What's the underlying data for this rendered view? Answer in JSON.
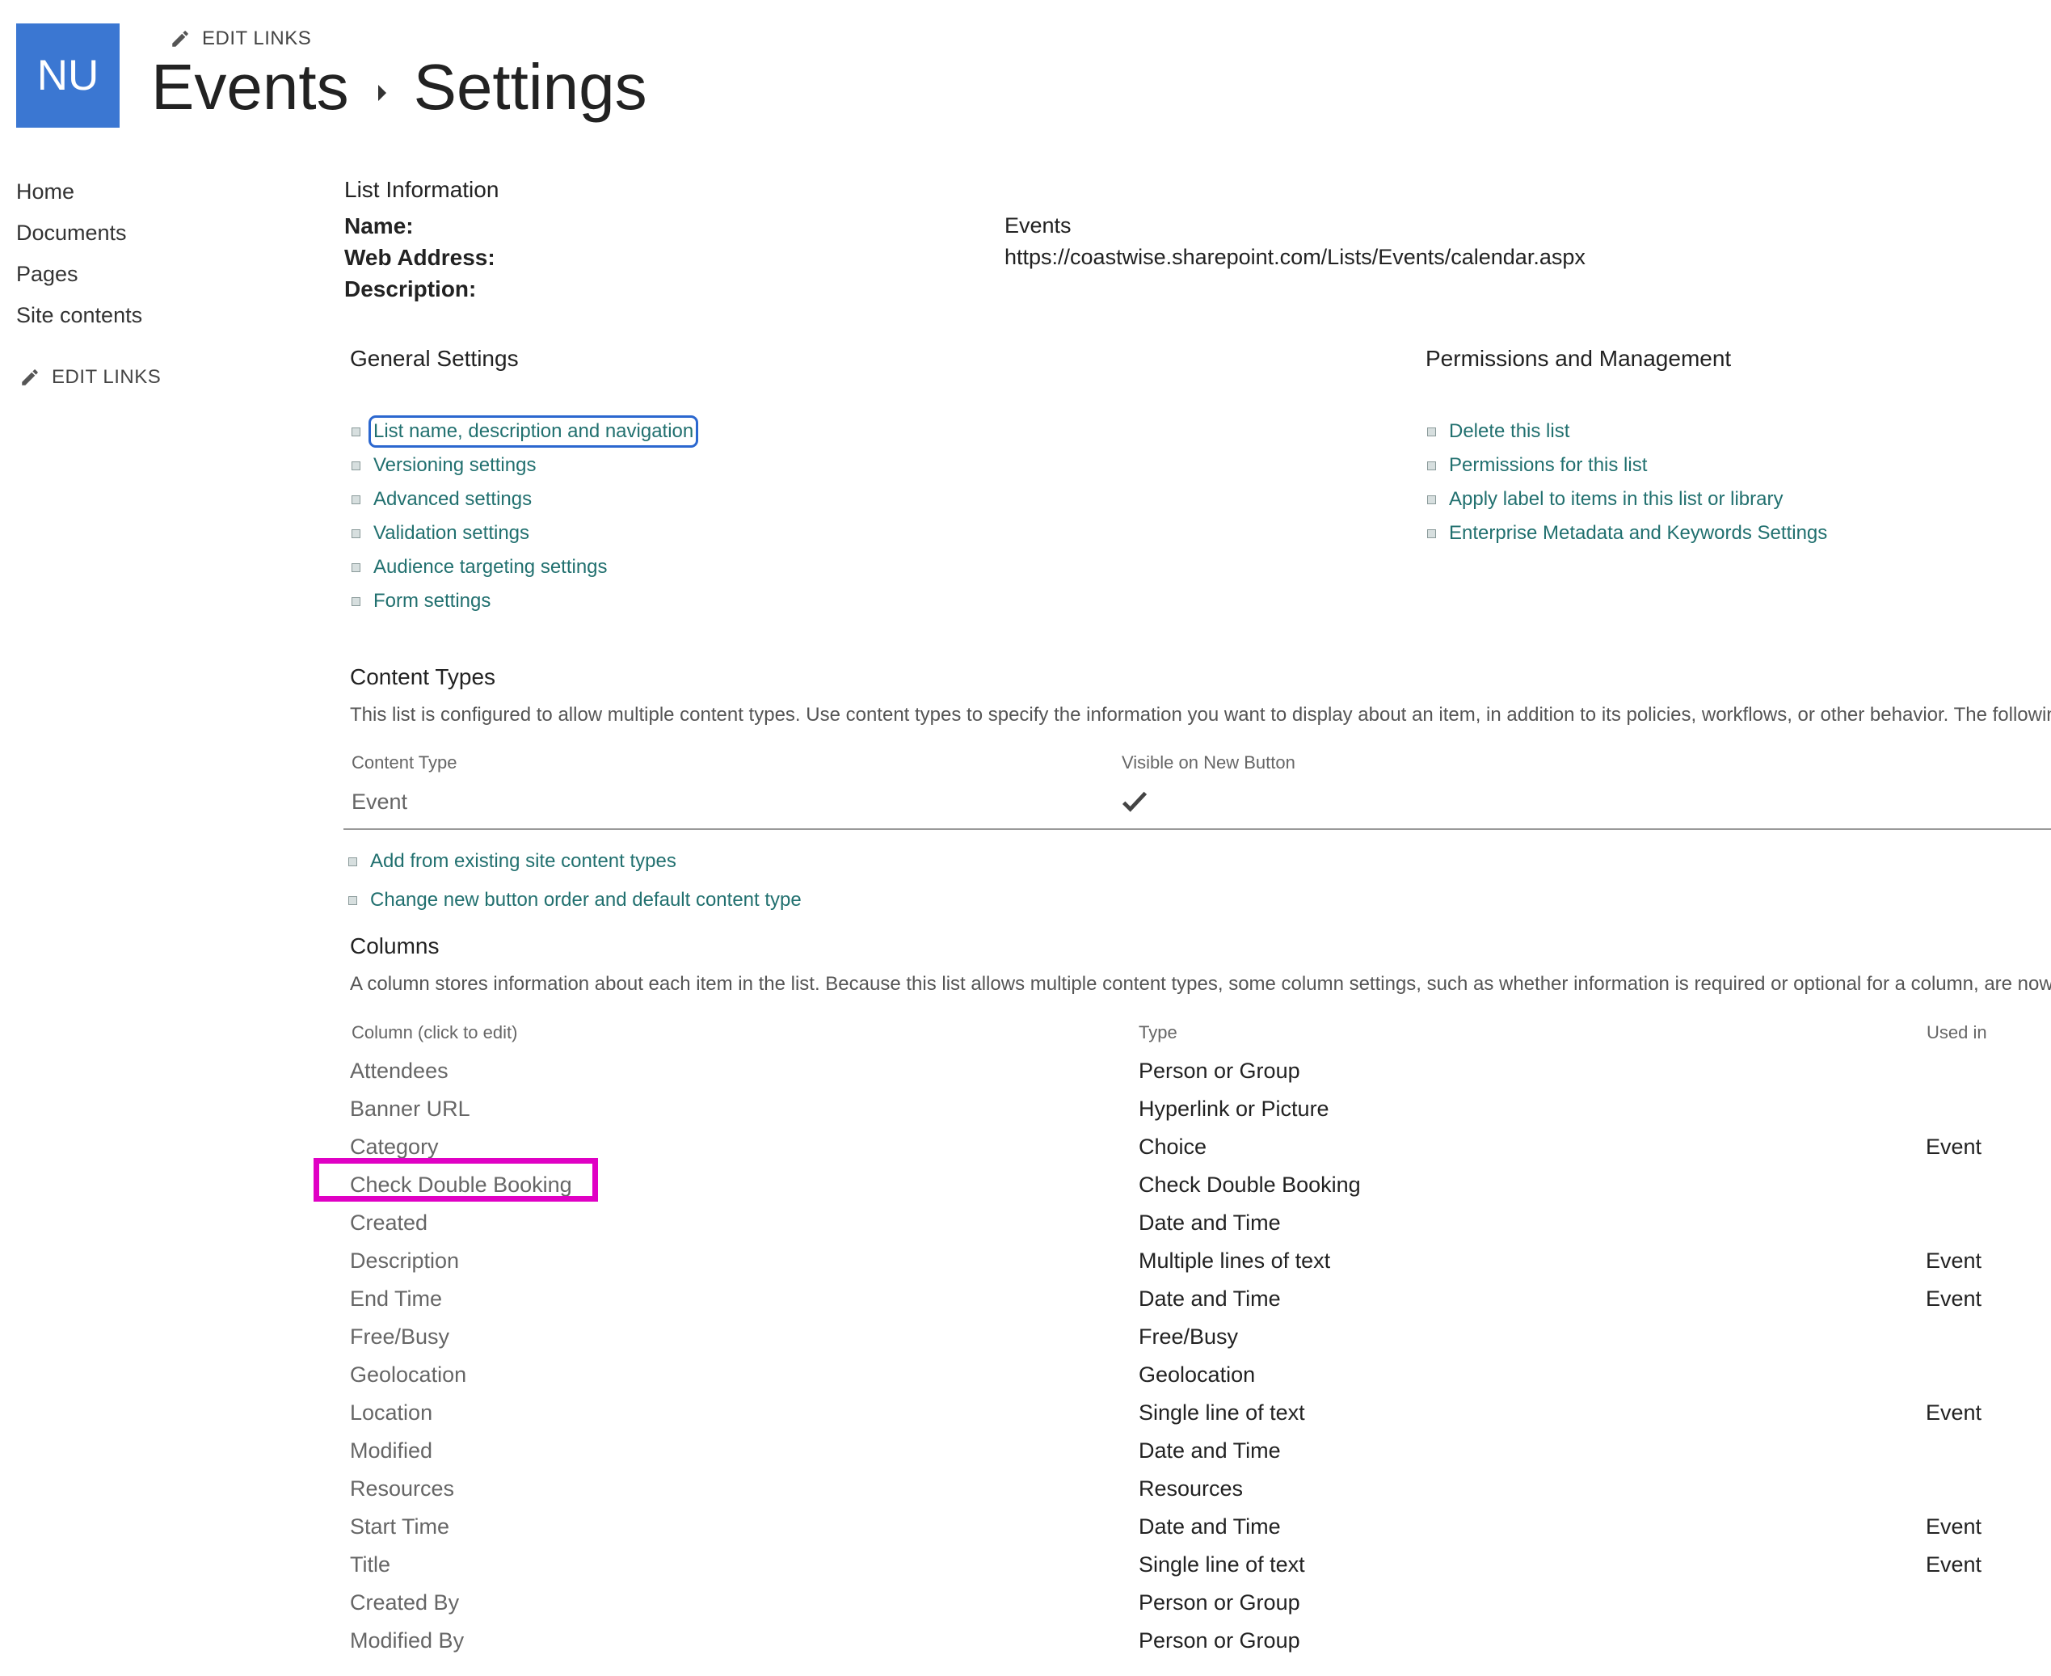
{
  "header": {
    "logo_text": "NU",
    "edit_links": "EDIT LINKS",
    "breadcrumb": [
      "Events",
      "Settings"
    ]
  },
  "nav": {
    "items": [
      "Home",
      "Documents",
      "Pages",
      "Site contents"
    ],
    "edit_links": "EDIT LINKS"
  },
  "list_info": {
    "heading": "List Information",
    "name_label": "Name:",
    "name_value": "Events",
    "web_address_label": "Web Address:",
    "web_address_value": "https://coastwise.sharepoint.com/Lists/Events/calendar.aspx",
    "description_label": "Description:"
  },
  "general_settings": {
    "heading": "General Settings",
    "links": [
      "List name, description and navigation",
      "Versioning settings",
      "Advanced settings",
      "Validation settings",
      "Audience targeting settings",
      "Form settings"
    ]
  },
  "permissions": {
    "heading": "Permissions and Management",
    "links": [
      "Delete this list",
      "Permissions for this list",
      "Apply label to items in this list or library",
      "Enterprise Metadata and Keywords Settings"
    ]
  },
  "content_types": {
    "heading": "Content Types",
    "description": "This list is configured to allow multiple content types. Use content types to specify the information you want to display about an item, in addition to its policies, workflows, or other behavior. The following",
    "col_headers": [
      "Content Type",
      "Visible on New Button"
    ],
    "rows": [
      {
        "name": "Event",
        "visible_icon": "checkmark-icon"
      }
    ],
    "links": [
      "Add from existing site content types",
      "Change new button order and default content type"
    ]
  },
  "columns": {
    "heading": "Columns",
    "description": "A column stores information about each item in the list. Because this list allows multiple content types, some column settings, such as whether information is required or optional for a column, are now spe",
    "col_headers": [
      "Column (click to edit)",
      "Type",
      "Used in"
    ],
    "rows": [
      {
        "name": "Attendees",
        "type": "Person or Group",
        "used_in": ""
      },
      {
        "name": "Banner URL",
        "type": "Hyperlink or Picture",
        "used_in": ""
      },
      {
        "name": "Category",
        "type": "Choice",
        "used_in": "Event"
      },
      {
        "name": "Check Double Booking",
        "type": "Check Double Booking",
        "used_in": ""
      },
      {
        "name": "Created",
        "type": "Date and Time",
        "used_in": ""
      },
      {
        "name": "Description",
        "type": "Multiple lines of text",
        "used_in": "Event"
      },
      {
        "name": "End Time",
        "type": "Date and Time",
        "used_in": "Event"
      },
      {
        "name": "Free/Busy",
        "type": "Free/Busy",
        "used_in": ""
      },
      {
        "name": "Geolocation",
        "type": "Geolocation",
        "used_in": ""
      },
      {
        "name": "Location",
        "type": "Single line of text",
        "used_in": "Event"
      },
      {
        "name": "Modified",
        "type": "Date and Time",
        "used_in": ""
      },
      {
        "name": "Resources",
        "type": "Resources",
        "used_in": ""
      },
      {
        "name": "Start Time",
        "type": "Date and Time",
        "used_in": "Event"
      },
      {
        "name": "Title",
        "type": "Single line of text",
        "used_in": "Event"
      },
      {
        "name": "Created By",
        "type": "Person or Group",
        "used_in": ""
      },
      {
        "name": "Modified By",
        "type": "Person or Group",
        "used_in": ""
      }
    ]
  },
  "colors": {
    "logo_bg": "#3b77d2",
    "link": "#21706f",
    "highlight_box": "#e000c4",
    "focus_outline": "#2b67cf"
  }
}
